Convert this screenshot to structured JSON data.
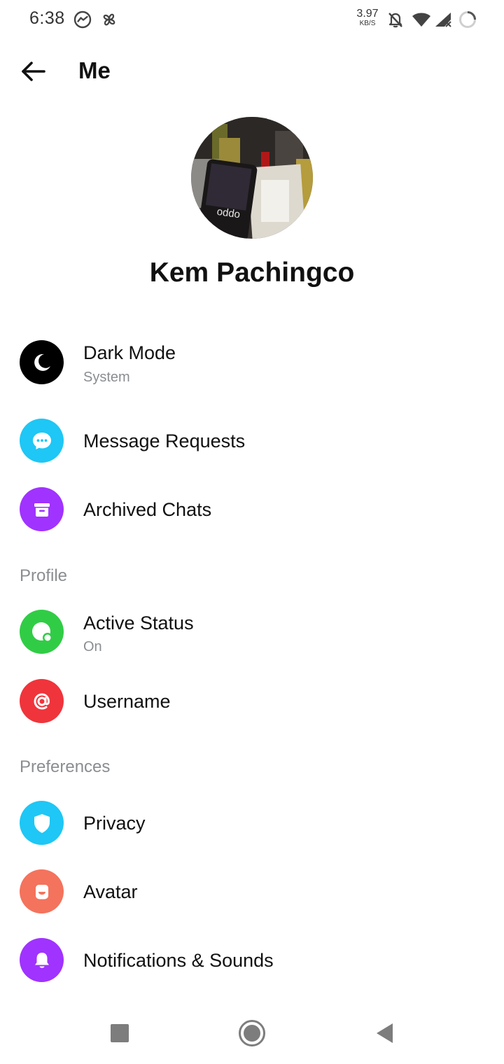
{
  "status_bar": {
    "time": "6:38",
    "net_speed": "3.97",
    "net_unit": "KB/S",
    "icons": [
      "messenger-icon",
      "pinwheel-icon",
      "bell-off-icon",
      "wifi-icon",
      "cell-signal-icon",
      "loading-ring-icon"
    ]
  },
  "header": {
    "title": "Me"
  },
  "profile": {
    "name": "Kem Pachingco",
    "photo_text": "oppo"
  },
  "sections": {
    "profile": "Profile",
    "preferences": "Preferences"
  },
  "menu": {
    "dark_mode": {
      "label": "Dark Mode",
      "sub": "System",
      "icon": "moon-icon",
      "color": "#000000"
    },
    "message_requests": {
      "label": "Message Requests",
      "icon": "chat-bubble-icon",
      "color": "#1ec7f5"
    },
    "archived_chats": {
      "label": "Archived Chats",
      "icon": "archive-box-icon",
      "color": "#a033ff"
    },
    "active_status": {
      "label": "Active Status",
      "sub": "On",
      "icon": "active-status-icon",
      "color": "#31cc46"
    },
    "username": {
      "label": "Username",
      "icon": "at-sign-icon",
      "color": "#f0343b"
    },
    "privacy": {
      "label": "Privacy",
      "icon": "shield-icon",
      "color": "#1ec7f5"
    },
    "avatar": {
      "label": "Avatar",
      "icon": "avatar-face-icon",
      "color": "#f4735d"
    },
    "notifications": {
      "label": "Notifications & Sounds",
      "icon": "bell-icon",
      "color": "#a033ff"
    }
  },
  "nav_bar": {
    "buttons": [
      "recents-square-icon",
      "home-circle-icon",
      "back-triangle-icon"
    ]
  }
}
